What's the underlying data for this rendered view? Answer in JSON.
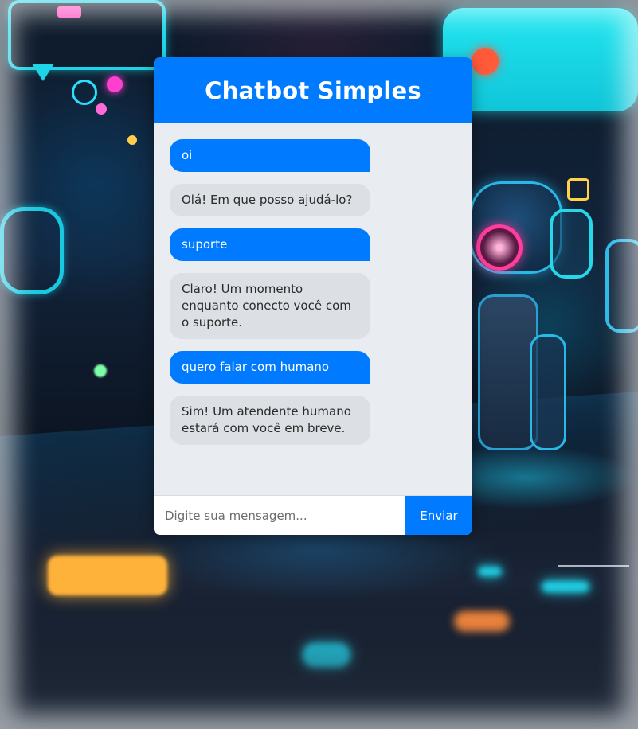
{
  "header": {
    "title": "Chatbot Simples"
  },
  "messages": [
    {
      "sender": "user",
      "text": "oi"
    },
    {
      "sender": "bot",
      "text": "Olá! Em que posso ajudá-lo?"
    },
    {
      "sender": "user",
      "text": "suporte"
    },
    {
      "sender": "bot",
      "text": "Claro! Um momento enquanto conecto você com o suporte."
    },
    {
      "sender": "user",
      "text": "quero falar com humano"
    },
    {
      "sender": "bot",
      "text": "Sim! Um atendente humano estará com você em breve."
    }
  ],
  "composer": {
    "placeholder": "Digite sua mensagem...",
    "value": "",
    "send_label": "Enviar"
  },
  "colors": {
    "accent": "#007bff",
    "bot_bubble": "#dcdfe3",
    "chat_background": "#e9edf1"
  }
}
